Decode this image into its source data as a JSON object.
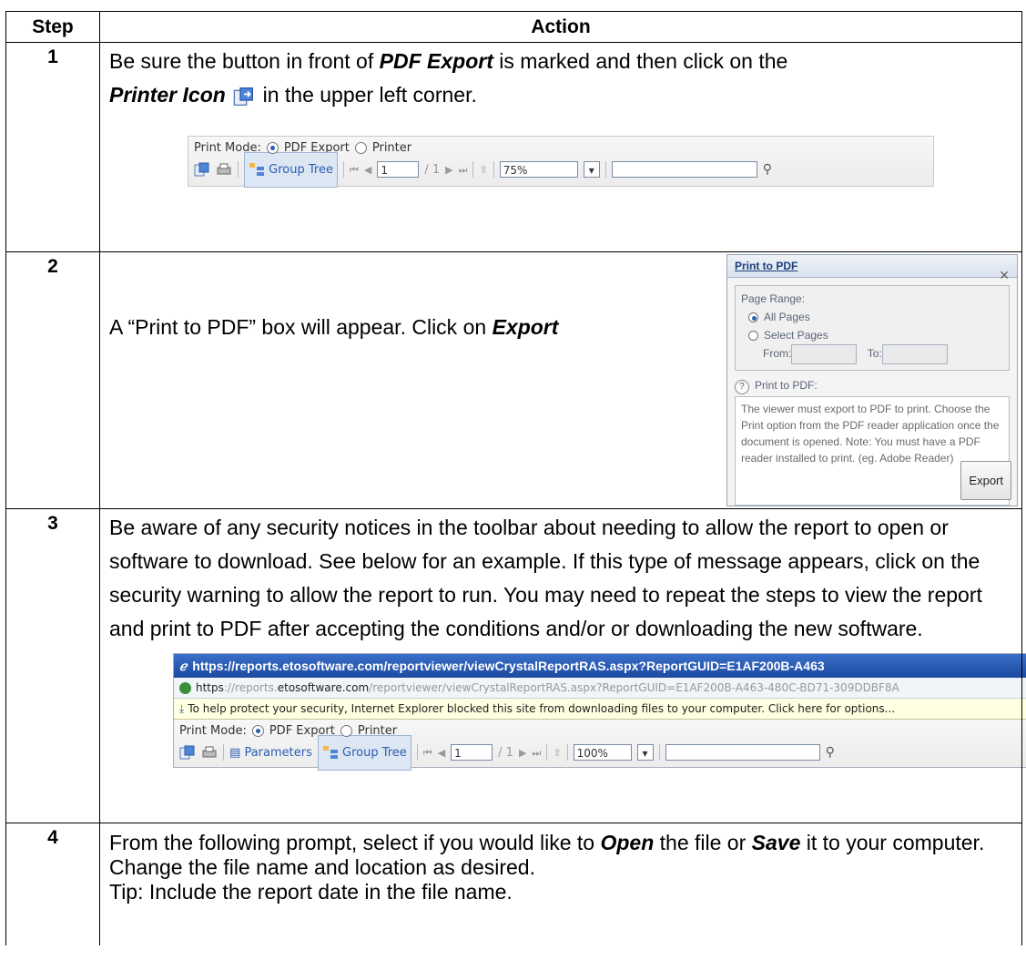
{
  "table": {
    "header_step": "Step",
    "header_action": "Action"
  },
  "step1": {
    "num": "1",
    "text_a": "Be sure the button in front of ",
    "pdf_export": "PDF Export",
    "text_b": " is marked and then click on the ",
    "printer_icon": "Printer Icon",
    "text_c": " in the upper left corner."
  },
  "toolbar1": {
    "print_mode": "Print Mode:",
    "pdf_export": "PDF Export",
    "printer": "Printer",
    "group_tree": "Group Tree",
    "page": "1",
    "of_pages": "/ 1",
    "zoom": "75%"
  },
  "step2": {
    "num": "2",
    "text_a": "A “Print to PDF” box will appear.  Click on ",
    "export": "Export"
  },
  "dialog": {
    "title": "Print to PDF",
    "page_range": "Page Range:",
    "all_pages": "All Pages",
    "select_pages": "Select Pages",
    "from": "From:",
    "to": "To:",
    "help_title": "Print to PDF:",
    "help_text": "The viewer must export to PDF to print. Choose the Print option from the PDF reader application once the document is opened. Note: You must have a PDF reader installed to print. (eg. Adobe Reader)",
    "export_button": "Export"
  },
  "step3": {
    "num": "3",
    "text": "Be aware of any security notices in the toolbar about needing to allow the report to open or software to download. See below for an example. If this type of message appears, click on the security warning to allow the report to run. You may need to repeat the steps to view the report and print to PDF after accepting the conditions and/or or downloading the new software."
  },
  "ie": {
    "title_url": "https://reports.etosoftware.com/reportviewer/viewCrystalReportRAS.aspx?ReportGUID=E1AF200B-A463",
    "addr_https": "https",
    "addr_mid": "://reports.",
    "addr_domain": "etosoftware.com",
    "addr_rest": "/reportviewer/viewCrystalReportRAS.aspx?ReportGUID=E1AF200B-A463-480C-BD71-309DDBF8A",
    "warning": "To help protect your security, Internet Explorer blocked this site from downloading files to your computer. Click here for options...",
    "print_mode": "Print Mode:",
    "pdf_export": "PDF Export",
    "printer": "Printer",
    "parameters": "Parameters",
    "group_tree": "Group Tree",
    "page": "1",
    "of_pages": "/ 1",
    "zoom": "100%"
  },
  "step4": {
    "num": "4",
    "text_a": "From the following prompt, select if you would like to ",
    "open": "Open",
    "text_b": " the file or ",
    "save": "Save",
    "text_c": " it to your computer. Change the file name and location as desired.",
    "tip": "Tip: Include the report date in the file name."
  }
}
